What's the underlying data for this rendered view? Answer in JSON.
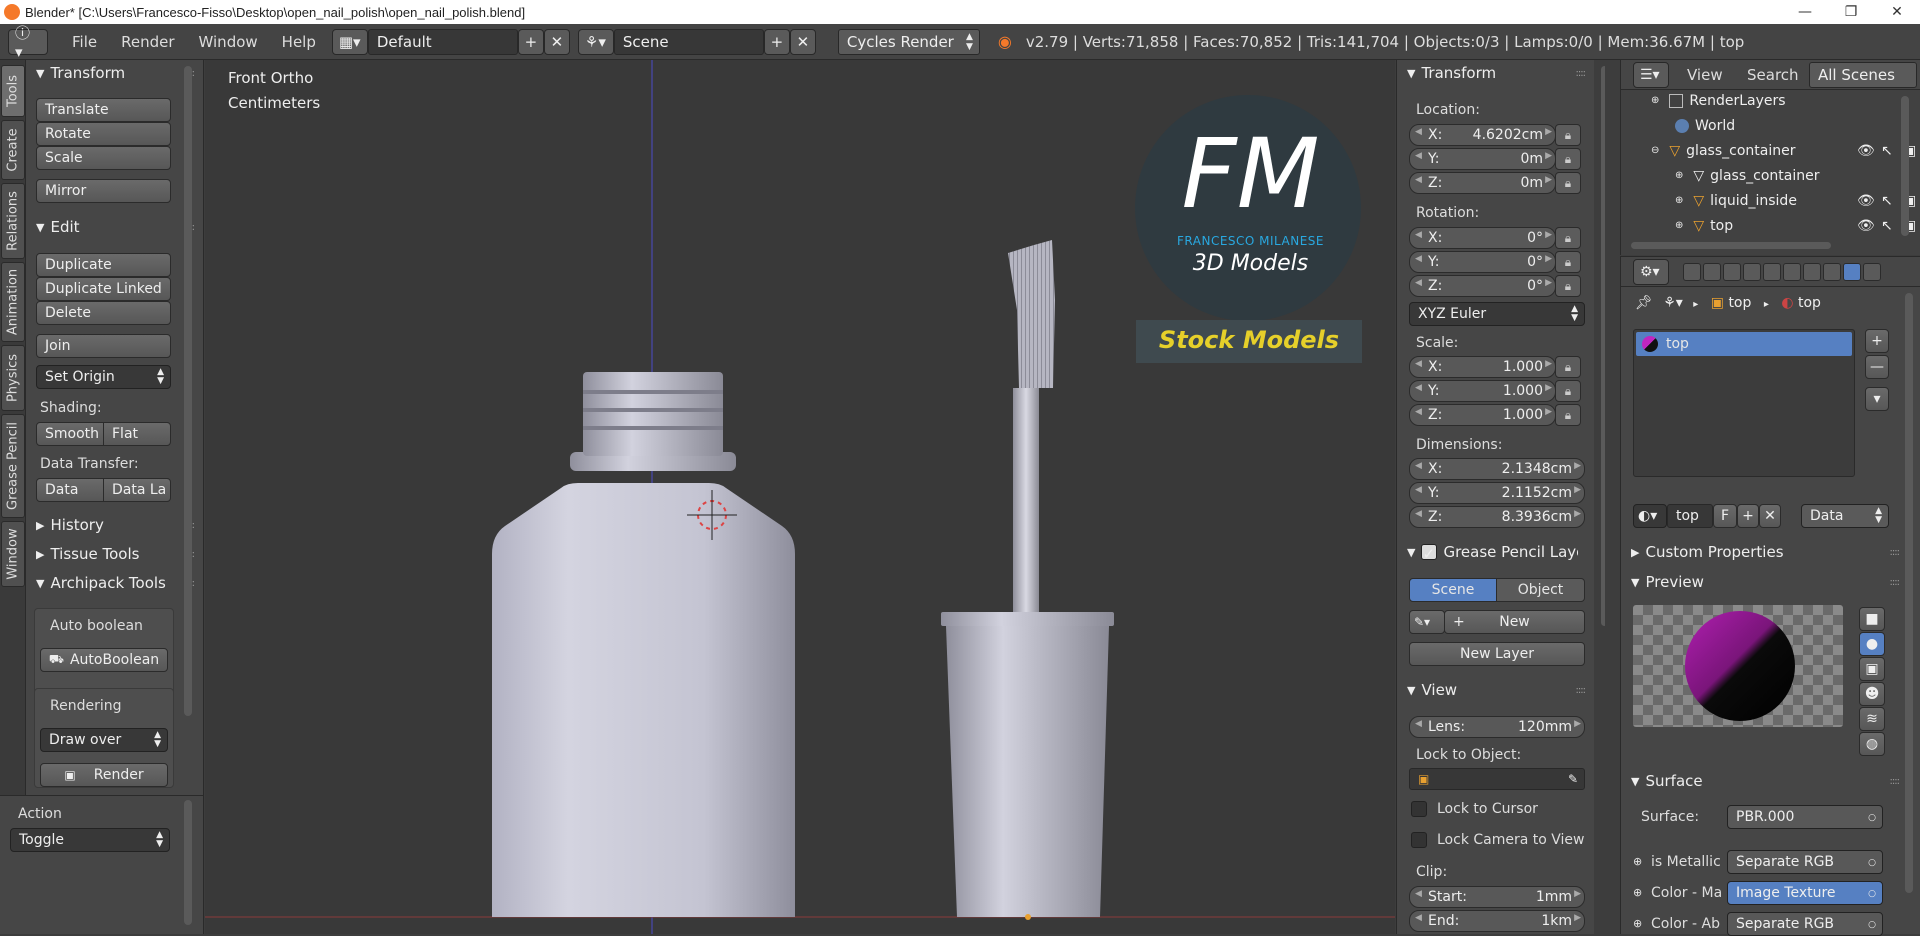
{
  "window": {
    "title": "Blender* [C:\\Users\\Francesco-Fisso\\Desktop\\open_nail_polish\\open_nail_polish.blend]"
  },
  "menubar": {
    "menus": [
      "File",
      "Render",
      "Window",
      "Help"
    ],
    "layout": "Default",
    "scene": "Scene",
    "engine": "Cycles Render",
    "stats": "v2.79 | Verts:71,858 | Faces:70,852 | Tris:141,704 | Objects:0/3 | Lamps:0/0 | Mem:36.67M | top"
  },
  "left_tabs": [
    "Tools",
    "Create",
    "Relations",
    "Animation",
    "Physics",
    "Grease Pencil",
    "Window"
  ],
  "tools": {
    "transform": {
      "title": "Transform",
      "translate": "Translate",
      "rotate": "Rotate",
      "scale": "Scale",
      "mirror": "Mirror"
    },
    "edit": {
      "title": "Edit",
      "duplicate": "Duplicate",
      "duplicate_linked": "Duplicate Linked",
      "delete": "Delete",
      "join": "Join",
      "set_origin": "Set Origin",
      "shading": "Shading:",
      "smooth": "Smooth",
      "flat": "Flat",
      "data_transfer": "Data Transfer:",
      "data": "Data",
      "data_la": "Data La"
    },
    "history": "History",
    "tissue": "Tissue Tools",
    "archipack": {
      "title": "Archipack Tools",
      "auto_boolean": "Auto boolean",
      "autoboolean_btn": "AutoBoolean",
      "rendering": "Rendering",
      "draw_over": "Draw over",
      "render_btn": "Render"
    }
  },
  "operator": {
    "title": "Action",
    "value": "Toggle"
  },
  "viewport": {
    "view_name": "Front Ortho",
    "units": "Centimeters"
  },
  "logo": {
    "letters": "FM",
    "name": "FRANCESCO MILANESE",
    "tagline": "3D Models",
    "banner": "Stock Models"
  },
  "npanel": {
    "transform": {
      "title": "Transform",
      "location_label": "Location:",
      "location": [
        {
          "k": "X:",
          "v": "4.6202cm"
        },
        {
          "k": "Y:",
          "v": "0m"
        },
        {
          "k": "Z:",
          "v": "0m"
        }
      ],
      "rotation_label": "Rotation:",
      "rotation": [
        {
          "k": "X:",
          "v": "0°"
        },
        {
          "k": "Y:",
          "v": "0°"
        },
        {
          "k": "Z:",
          "v": "0°"
        }
      ],
      "rotation_mode": "XYZ Euler",
      "scale_label": "Scale:",
      "scale": [
        {
          "k": "X:",
          "v": "1.000"
        },
        {
          "k": "Y:",
          "v": "1.000"
        },
        {
          "k": "Z:",
          "v": "1.000"
        }
      ],
      "dimensions_label": "Dimensions:",
      "dimensions": [
        {
          "k": "X:",
          "v": "2.1348cm"
        },
        {
          "k": "Y:",
          "v": "2.1152cm"
        },
        {
          "k": "Z:",
          "v": "8.3936cm"
        }
      ]
    },
    "grease": {
      "title": "Grease Pencil Layer",
      "scene": "Scene",
      "object": "Object",
      "new": "New",
      "new_layer": "New Layer"
    },
    "view": {
      "title": "View",
      "lens_label": "Lens:",
      "lens": "120mm",
      "lock_to_object": "Lock to Object:",
      "lock_to_cursor": "Lock to Cursor",
      "lock_camera": "Lock Camera to View",
      "clip": "Clip:",
      "start_label": "Start:",
      "start": "1mm",
      "end_label": "End:",
      "end": "1km"
    }
  },
  "outliner": {
    "header": {
      "view": "View",
      "search": "Search",
      "all_scenes": "All Scenes"
    },
    "rows": [
      "RenderLayers",
      "World",
      "glass_container",
      "glass_container",
      "liquid_inside",
      "top"
    ]
  },
  "properties": {
    "breadcrumb": [
      "top",
      "top"
    ],
    "slot": "top",
    "material_name": "top",
    "f_label": "F",
    "data_mode": "Data",
    "custom_props": "Custom Properties",
    "preview": "Preview",
    "surface": {
      "title": "Surface",
      "surface_label": "Surface:",
      "surface_value": "PBR.000",
      "inputs": [
        {
          "k": "is Metallic",
          "v": "Separate RGB"
        },
        {
          "k": "Color - Ma",
          "v": "Image Texture"
        },
        {
          "k": "Color - Ab",
          "v": "Separate RGB"
        }
      ]
    }
  },
  "colors": {
    "accent": "#5680c2",
    "logo_blue": "#29a8e0",
    "banner_yellow": "#e6d02a"
  }
}
